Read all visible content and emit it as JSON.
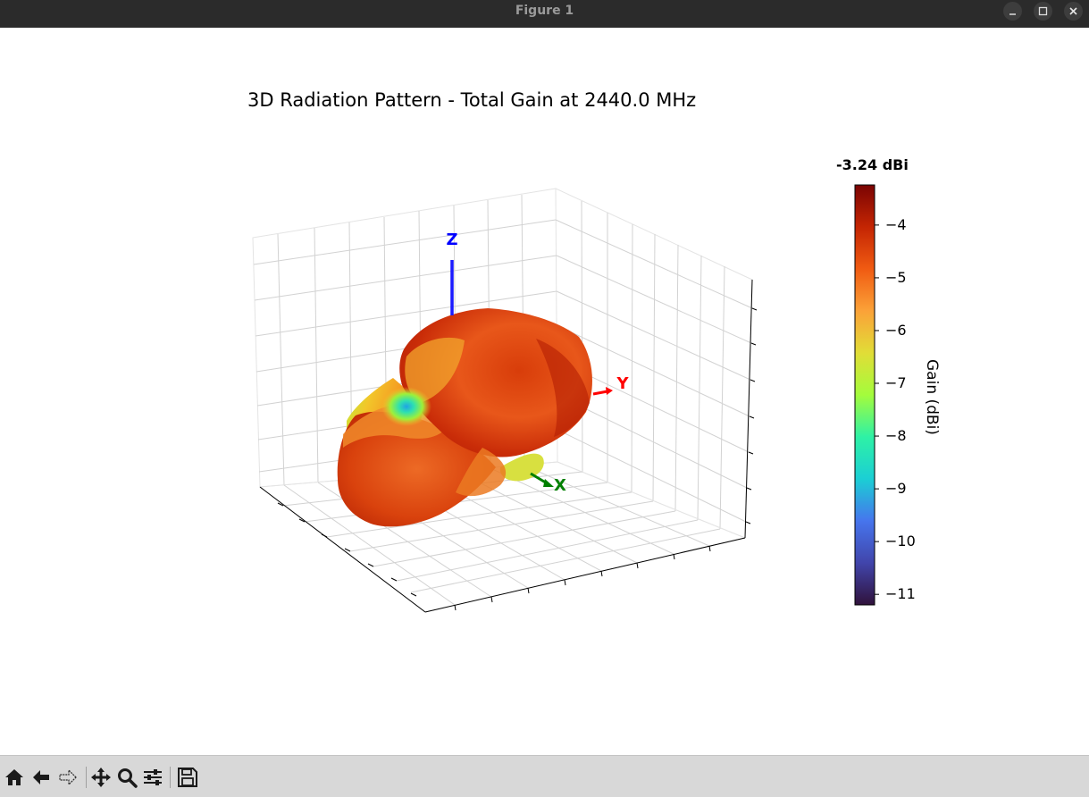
{
  "window": {
    "title": "Figure 1"
  },
  "window_controls": [
    "minimize-icon",
    "maximize-icon",
    "close-icon"
  ],
  "toolbar": {
    "buttons": [
      "home-icon",
      "back-icon",
      "forward-icon",
      "pan-icon",
      "zoom-icon",
      "configure-subplots-icon",
      "save-icon"
    ]
  },
  "chart_data": {
    "type": "surface",
    "title": "3D Radiation Pattern - Total Gain at 2440.0 MHz",
    "axes": {
      "x": {
        "label": "X",
        "color": "#007f00"
      },
      "y": {
        "label": "Y",
        "color": "#ff0000"
      },
      "z": {
        "label": "Z",
        "color": "#0000ff"
      }
    },
    "grid": true,
    "tick_labels_shown": false,
    "colorbar": {
      "title": "-3.24 dBi",
      "label": "Gain (dBi)",
      "colormap": "turbo",
      "range": [
        -11.2,
        -3.24
      ],
      "ticks": [
        "−4",
        "−5",
        "−6",
        "−7",
        "−8",
        "−9",
        "−10",
        "−11"
      ],
      "tick_values": [
        -4,
        -5,
        -6,
        -7,
        -8,
        -9,
        -10,
        -11
      ]
    },
    "max_gain_dbi": -3.24,
    "frequency_mhz": 2440.0
  }
}
